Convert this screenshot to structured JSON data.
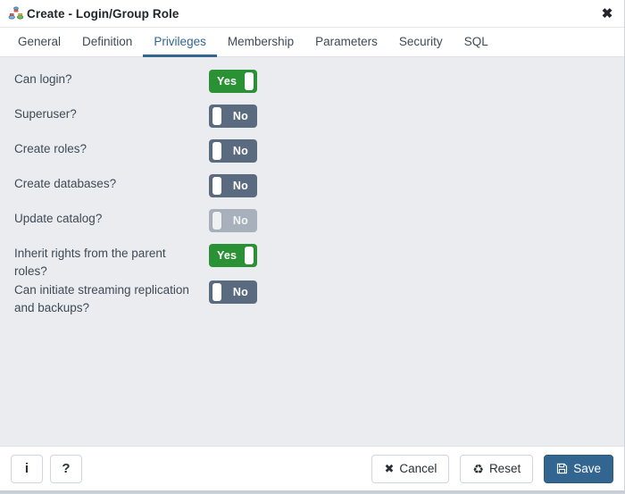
{
  "window": {
    "title": "Create - Login/Group Role",
    "icon": "login-group-role-icon",
    "close_label": "✖"
  },
  "tabs": [
    {
      "label": "General",
      "active": false
    },
    {
      "label": "Definition",
      "active": false
    },
    {
      "label": "Privileges",
      "active": true
    },
    {
      "label": "Membership",
      "active": false
    },
    {
      "label": "Parameters",
      "active": false
    },
    {
      "label": "Security",
      "active": false
    },
    {
      "label": "SQL",
      "active": false
    }
  ],
  "privileges": [
    {
      "label": "Can login?",
      "value": "Yes",
      "state": "on",
      "disabled": false
    },
    {
      "label": "Superuser?",
      "value": "No",
      "state": "off",
      "disabled": false
    },
    {
      "label": "Create roles?",
      "value": "No",
      "state": "off",
      "disabled": false
    },
    {
      "label": "Create databases?",
      "value": "No",
      "state": "off",
      "disabled": false
    },
    {
      "label": "Update catalog?",
      "value": "No",
      "state": "off",
      "disabled": true
    },
    {
      "label": "Inherit rights from the parent roles?",
      "value": "Yes",
      "state": "on",
      "disabled": false
    },
    {
      "label": "Can initiate streaming replication and backups?",
      "value": "No",
      "state": "off",
      "disabled": false
    }
  ],
  "footer": {
    "info_label": "i",
    "help_label": "?",
    "cancel_label": "Cancel",
    "cancel_icon": "✖",
    "reset_label": "Reset",
    "reset_icon": "♻",
    "save_label": "Save",
    "save_icon": "floppy-disk-icon"
  },
  "colors": {
    "accent": "#326690",
    "toggle_on": "#2a9134",
    "toggle_off": "#5b6b7f",
    "toggle_disabled": "#a7b0bb",
    "body_bg": "#eaecf0",
    "panel_bg": "#ffffff"
  }
}
